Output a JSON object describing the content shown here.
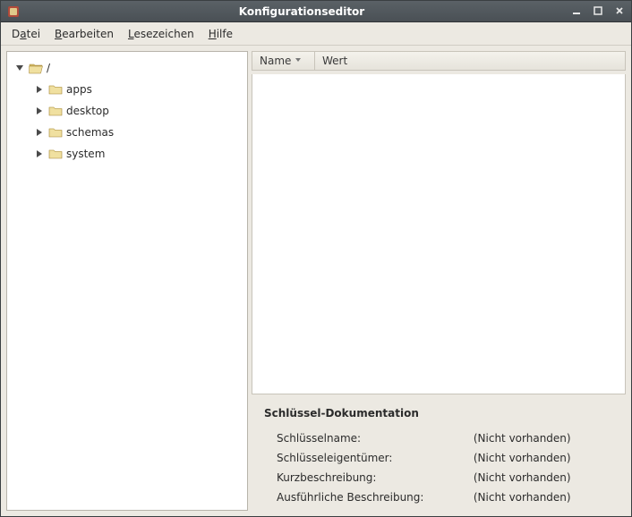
{
  "window": {
    "title": "Konfigurationseditor"
  },
  "menu": {
    "file_pre": "D",
    "file_ul": "a",
    "file_post": "tei",
    "edit_pre": "",
    "edit_ul": "B",
    "edit_post": "earbeiten",
    "bookmarks_pre": "",
    "bookmarks_ul": "L",
    "bookmarks_post": "esezeichen",
    "help_pre": "",
    "help_ul": "H",
    "help_post": "ilfe"
  },
  "tree": {
    "root_label": "/",
    "items": [
      {
        "label": "apps"
      },
      {
        "label": "desktop"
      },
      {
        "label": "schemas"
      },
      {
        "label": "system"
      }
    ]
  },
  "columns": {
    "name": "Name",
    "value": "Wert"
  },
  "doc": {
    "heading": "Schlüssel-Dokumentation",
    "rows": [
      {
        "label": "Schlüsselname:",
        "value": "(Nicht vorhanden)"
      },
      {
        "label": "Schlüsseleigentümer:",
        "value": "(Nicht vorhanden)"
      },
      {
        "label": "Kurzbeschreibung:",
        "value": "(Nicht vorhanden)"
      },
      {
        "label": "Ausführliche Beschreibung:",
        "value": "(Nicht vorhanden)"
      }
    ]
  }
}
